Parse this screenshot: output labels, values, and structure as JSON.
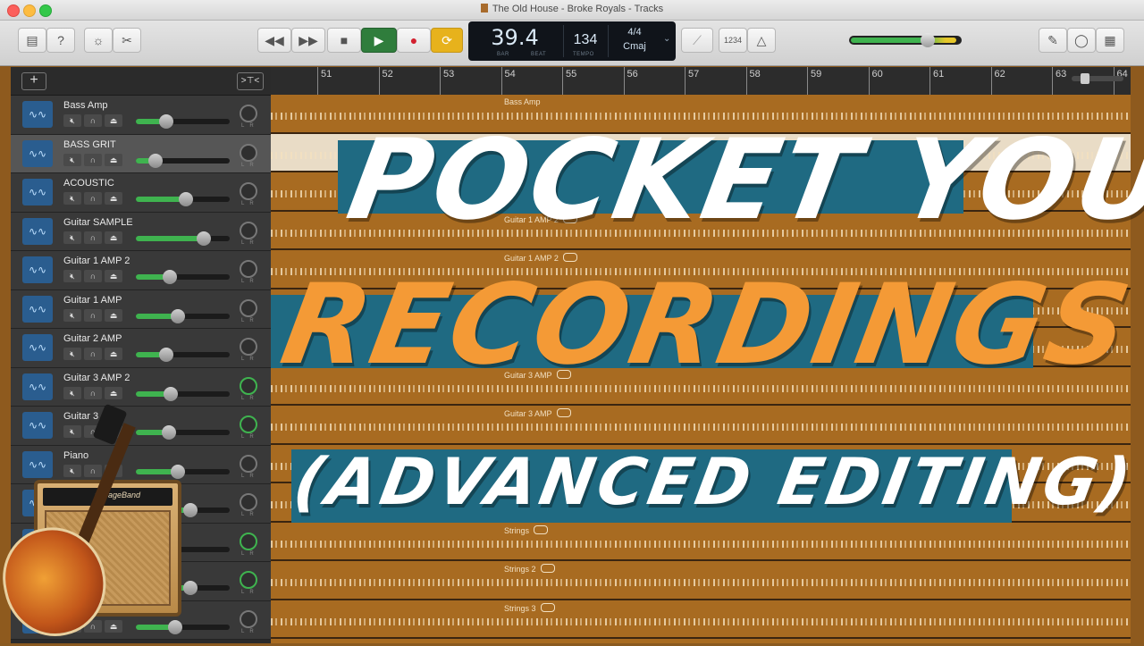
{
  "window": {
    "title": "The Old House - Broke Royals - Tracks"
  },
  "toolbar": {
    "left_icons": [
      "library-icon",
      "help-icon",
      "smart-controls-icon",
      "scissors-icon"
    ],
    "transport": [
      "rewind-icon",
      "fast-forward-icon",
      "stop-icon",
      "play-icon",
      "record-icon",
      "cycle-icon"
    ],
    "lcd": {
      "position": "39.4",
      "position_bar_label": "BAR",
      "position_beat_label": "BEAT",
      "tempo": "134",
      "tempo_label": "TEMPO",
      "time_signature": "4/4",
      "key": "Cmaj"
    },
    "tuner_icon": "tuner-icon",
    "count_in": "1234",
    "metronome_icon": "metronome-icon",
    "right_icons": [
      "notepad-icon",
      "loop-browser-icon",
      "media-browser-icon"
    ]
  },
  "tracks": [
    {
      "name": "Bass Amp",
      "volume": 0.32,
      "pan": "center",
      "selected": false
    },
    {
      "name": "BASS GRIT",
      "volume": 0.21,
      "pan": "center",
      "selected": true
    },
    {
      "name": "ACOUSTIC",
      "volume": 0.53,
      "pan": "center",
      "selected": false
    },
    {
      "name": "Guitar SAMPLE",
      "volume": 0.72,
      "pan": "center",
      "selected": false
    },
    {
      "name": "Guitar 1 AMP 2",
      "volume": 0.36,
      "pan": "center",
      "selected": false
    },
    {
      "name": "Guitar 1 AMP",
      "volume": 0.45,
      "pan": "center",
      "selected": false
    },
    {
      "name": "Guitar 2 AMP",
      "volume": 0.32,
      "pan": "center",
      "selected": false
    },
    {
      "name": "Guitar 3 AMP 2",
      "volume": 0.37,
      "pan": "left",
      "selected": false
    },
    {
      "name": "Guitar 3 AMP",
      "volume": 0.35,
      "pan": "right",
      "selected": false
    },
    {
      "name": "Piano",
      "volume": 0.45,
      "pan": "center",
      "selected": false
    },
    {
      "name": "",
      "volume": 0.58,
      "pan": "center",
      "selected": false
    },
    {
      "name": "",
      "volume": 0.32,
      "pan": "right",
      "selected": false
    },
    {
      "name": "",
      "volume": 0.58,
      "pan": "right",
      "selected": false
    },
    {
      "name": "",
      "volume": 0.42,
      "pan": "center",
      "selected": false
    }
  ],
  "ruler": {
    "bars": [
      "51",
      "52",
      "53",
      "54",
      "55",
      "56",
      "57",
      "58",
      "59",
      "60",
      "61",
      "62",
      "63",
      "64"
    ]
  },
  "regions": {
    "lane_0": "Bass Amp",
    "lane_3": "Guitar 1 AMP 2",
    "lane_4": "Guitar 1 AMP 2",
    "lane_7": "Guitar 3 AMP",
    "lane_8": "Guitar 3 AMP",
    "lane_11": "Strings",
    "lane_12": "Strings 2",
    "lane_13": "Strings 3"
  },
  "headline": {
    "line1": "POCKET YOUR",
    "line2": "RECORDINGS",
    "line3": "(ADVANCED EDITING)"
  },
  "logo": {
    "brand": "GarageBand"
  },
  "colors": {
    "banner": "#1f6a82",
    "orange_text": "#f49a36",
    "region_fill": "#a86b21",
    "track_icon": "#2a5d8f",
    "meter_green": "#3fb34f"
  }
}
